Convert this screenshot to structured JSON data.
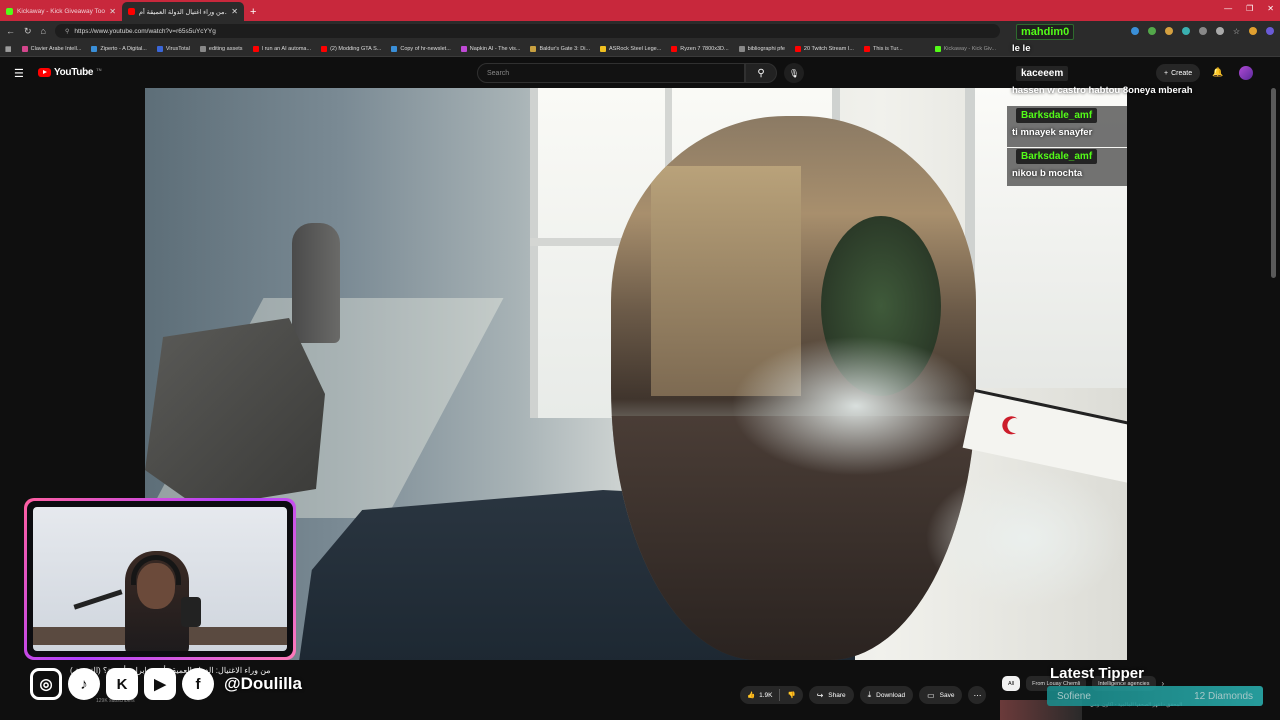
{
  "browser": {
    "tabs": [
      {
        "title": "Kickaway - Kick Giveaway Tool",
        "active": false,
        "favicon_color": "#53fc18"
      },
      {
        "title": "من وراء اغتيال الدولة العميقة أم...",
        "active": true,
        "favicon_color": "#ff0000"
      }
    ],
    "new_tab": "+",
    "url": "https://www.youtube.com/watch?v=r65s5uYcYYg",
    "bookmarks": [
      {
        "label": "Clavier Arabe Intell...",
        "color": "#d4468c"
      },
      {
        "label": "Ziperto - A Digital...",
        "color": "#3a8fd8"
      },
      {
        "label": "VirusTotal",
        "color": "#3a66d8"
      },
      {
        "label": "editing assets",
        "color": "#888888"
      },
      {
        "label": "I run an AI automa...",
        "color": "#ff0000"
      },
      {
        "label": "(2) Modding GTA S...",
        "color": "#ff0000"
      },
      {
        "label": "Copy of hr-newslet...",
        "color": "#3a8fd8"
      },
      {
        "label": "Napkin AI - The vis...",
        "color": "#c04ad6"
      },
      {
        "label": "Baldur's Gate 3: Di...",
        "color": "#c8a040"
      },
      {
        "label": "ASRock Steel Lege...",
        "color": "#f0c020"
      },
      {
        "label": "Ryzen 7 7800x3D...",
        "color": "#ff0000"
      },
      {
        "label": "bibliographi pfe",
        "color": "#888888"
      },
      {
        "label": "20 Twitch Stream I...",
        "color": "#ff0000"
      },
      {
        "label": "This is Tur...",
        "color": "#ff0000"
      }
    ],
    "extra_tab_label": "Kickaway - Kick Giv..."
  },
  "youtube": {
    "logo_text": "YouTube",
    "country": "TN",
    "search_placeholder": "Search",
    "create_label": "Create",
    "channel_subs": "129K subscribers",
    "video_title": "من وراء الاغتيال: الدولة العميقة أم مخابرات أجنبية؟ (التحقيق)",
    "likes": "1.9K",
    "share_label": "Share",
    "download_label": "Download",
    "save_label": "Save",
    "chips": [
      "All",
      "From Louay Chemli",
      "Intelligence agencies"
    ],
    "side_video_title": "المحقق - انتهز الصحفيا المالمية - أكاون. ومي"
  },
  "stream_overlay": {
    "handle": "@Doulilla",
    "social_icons": [
      "instagram-icon",
      "tiktok-icon",
      "kick-icon",
      "youtube-icon",
      "facebook-icon"
    ],
    "latest_tipper_label": "Latest Tipper",
    "tipper_name": "Sofiene",
    "tipper_amount": "12 Diamonds"
  },
  "chat": {
    "top_user": "mahdim0",
    "top_message": "le le",
    "messages": [
      {
        "user": "kaceeem",
        "text": "hassen w castro habtou 8oneya mberah",
        "user_color": "#ffffff"
      },
      {
        "user": "Barksdale_amf",
        "text": "ti mnayek snayfer",
        "user_color": "#53fc18"
      },
      {
        "user": "Barksdale_amf",
        "text": "nikou b mochta",
        "user_color": "#53fc18"
      }
    ]
  },
  "colors": {
    "tab_strip": "#c8283c",
    "kick_green": "#53fc18",
    "yt_red": "#ff0000",
    "cam_border": "#ff5fa0",
    "tipper_bar": "#2bb4b4"
  }
}
